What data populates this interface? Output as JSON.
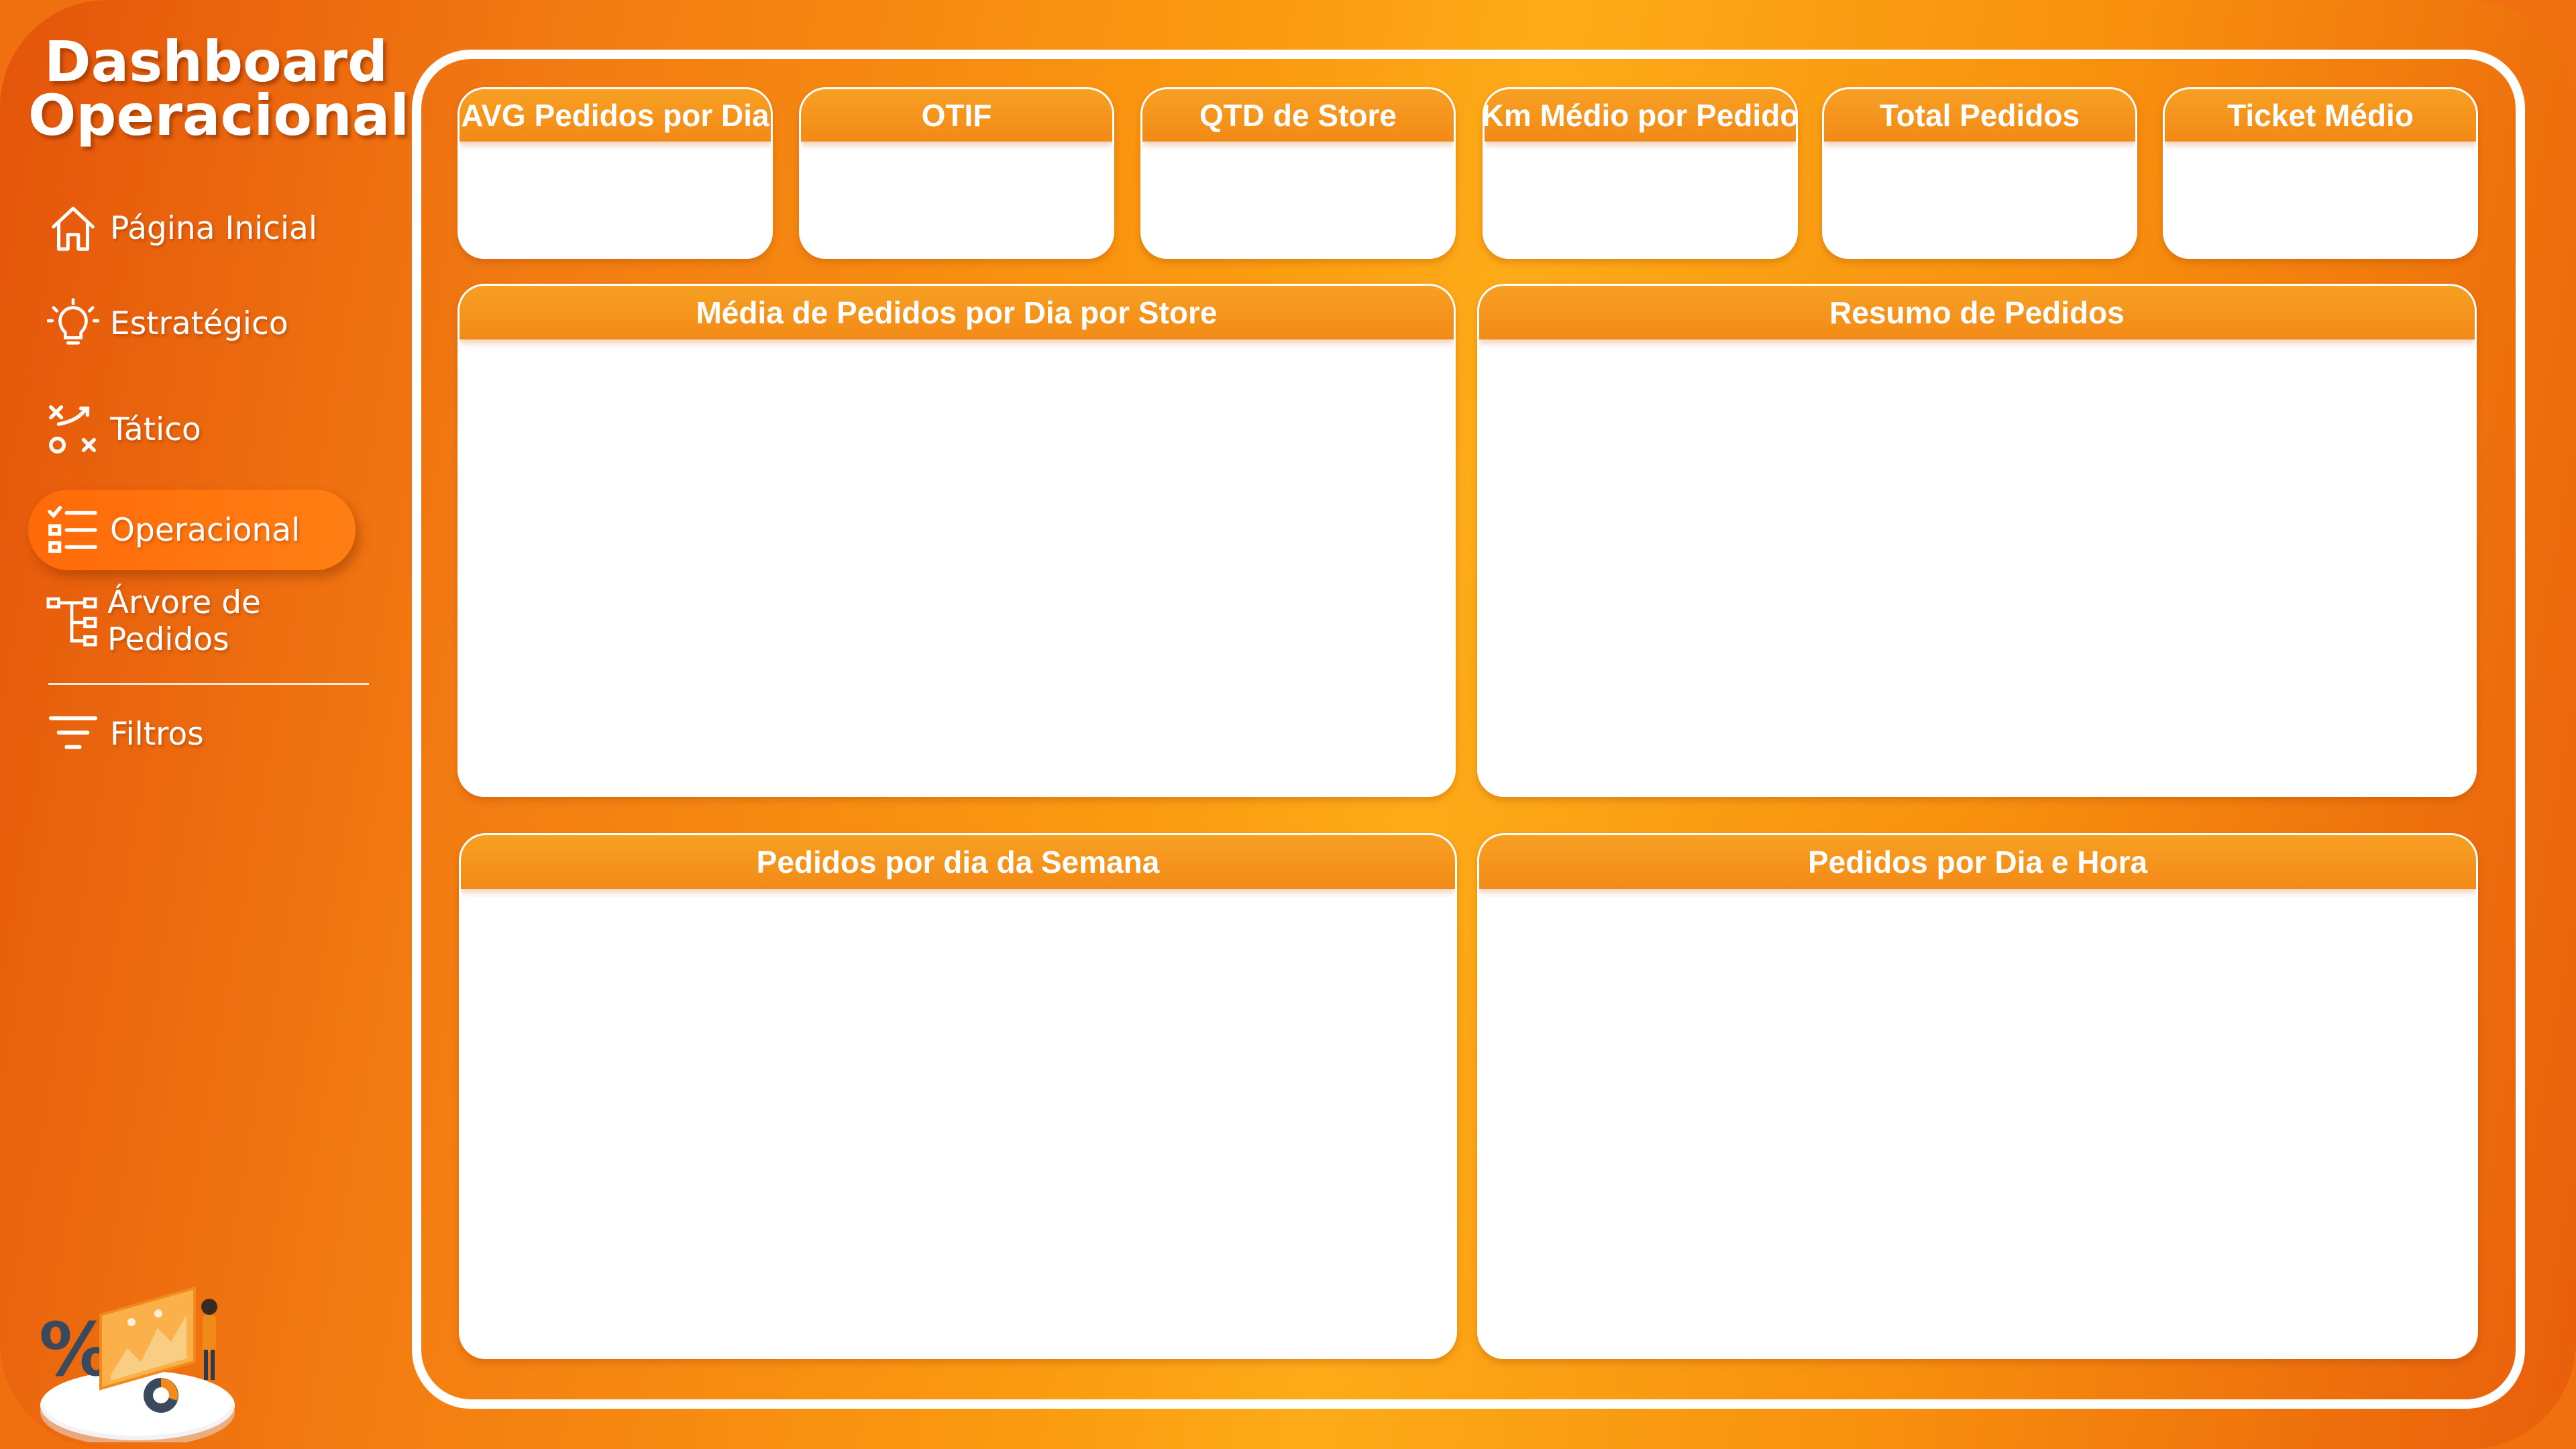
{
  "app": {
    "title_line1": "Dashboard",
    "title_line2": "Operacional"
  },
  "nav": {
    "items": [
      {
        "label": "Página Inicial",
        "icon": "home-icon"
      },
      {
        "label": "Estratégico",
        "icon": "lightbulb-icon"
      },
      {
        "label": "Tático",
        "icon": "tactics-icon"
      },
      {
        "label": "Operacional",
        "icon": "checklist-icon",
        "active": true
      },
      {
        "label": "Árvore de Pedidos",
        "icon": "tree-icon"
      }
    ],
    "filters_label": "Filtros",
    "active_color": "#ff6a08"
  },
  "kpis": [
    {
      "label": "AVG Pedidos por Dia"
    },
    {
      "label": "OTIF"
    },
    {
      "label": "QTD de Store"
    },
    {
      "label": "Km Médio por Pedido"
    },
    {
      "label": "Total Pedidos"
    },
    {
      "label": "Ticket Médio"
    }
  ],
  "charts": {
    "media_pedidos_store": {
      "title": "Média de Pedidos por Dia por Store"
    },
    "resumo_pedidos": {
      "title": "Resumo de Pedidos"
    },
    "pedidos_dia_semana": {
      "title": "Pedidos por dia da Semana"
    },
    "pedidos_dia_hora": {
      "title": "Pedidos por Dia e Hora"
    }
  },
  "theme": {
    "primary": "#f28a14",
    "header": "#f7a023",
    "background_dark": "#e4550a",
    "background_light": "#fdab18"
  }
}
